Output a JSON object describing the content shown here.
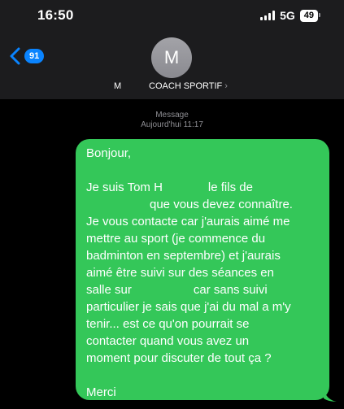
{
  "status_bar": {
    "time": "16:50",
    "network": "5G",
    "battery": "49"
  },
  "nav": {
    "back_count": "91"
  },
  "contact": {
    "avatar_initial": "M",
    "initial_label": "M",
    "name": "COACH SPORTIF",
    "chevron": "›"
  },
  "thread": {
    "service": "Message",
    "timestamp": "Aujourd'hui 11:17"
  },
  "message": {
    "greeting": "Bonjour,",
    "line1a": "Je suis Tom H",
    "line1b": "le fils de",
    "line2": "que vous devez connaître.",
    "line3": "Je vous contacte car j'aurais aimé me",
    "line4": "mettre au sport (je commence du",
    "line5": "badminton en septembre) et j'aurais",
    "line6": "aimé être suivi sur des séances en",
    "line7a": "salle sur",
    "line7b": "car sans suivi",
    "line8": "particulier je sais que j'ai du mal a m'y",
    "line9": "tenir... est ce qu'on pourrait se",
    "line10": "contacter quand vous avez un",
    "line11": "moment pour discuter de tout ça ?",
    "closing": "Merci"
  },
  "colors": {
    "bubble": "#34c759",
    "accent": "#0a84ff",
    "header": "#1c1c1e"
  },
  "icons": [
    "back-chevron-icon",
    "signal-icon",
    "battery-icon",
    "chevron-right-icon",
    "bubble-tail-icon"
  ]
}
